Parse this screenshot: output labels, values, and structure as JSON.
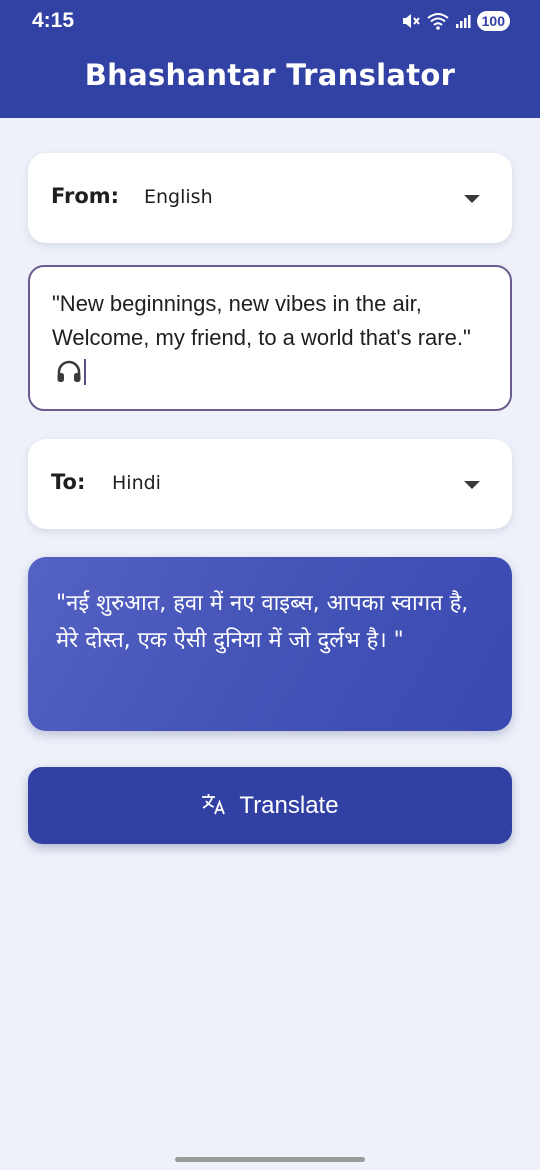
{
  "status_bar": {
    "time": "4:15",
    "battery": "100",
    "icons": [
      "mute-icon",
      "wifi-icon",
      "signal-icon",
      "battery-icon"
    ]
  },
  "app": {
    "title": "Bhashantar Translator",
    "accent_color": "#3241a4"
  },
  "source": {
    "label": "From:",
    "language": "English",
    "input_text": "\"New beginnings, new vibes in the air, Welcome, my friend, to a world that's rare.\" ",
    "input_icon": "headphone-icon"
  },
  "target": {
    "label": "To:",
    "language": "Hindi"
  },
  "output": {
    "text": "\"नई शुरुआत, हवा में नए वाइब्स, आपका स्वागत है, मेरे दोस्त, एक ऐसी दुनिया में जो दुर्लभ है। \""
  },
  "translate_button": {
    "label": "Translate",
    "icon": "translate-icon"
  }
}
